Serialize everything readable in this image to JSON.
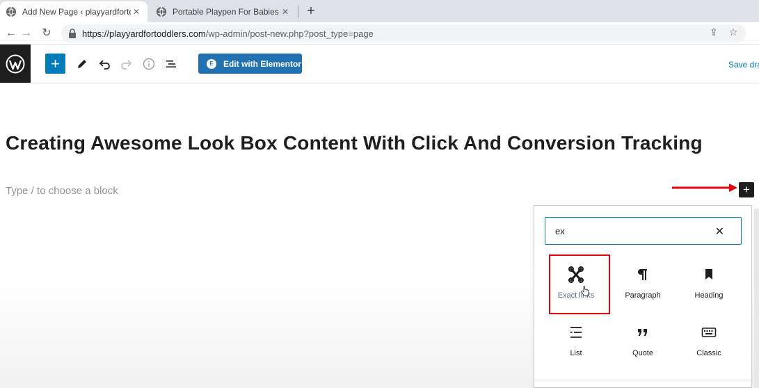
{
  "browser": {
    "tabs": [
      {
        "title": "Add New Page ‹ playyardfortodd",
        "active": true
      },
      {
        "title": "Portable Playpen For Babies [ Pla",
        "active": false
      }
    ],
    "tab_close": "✕",
    "new_tab": "+",
    "url_host": "https://playyardfortoddlers.com",
    "url_path": "/wp-admin/post-new.php?post_type=page"
  },
  "toolbar": {
    "inserter_label": "+",
    "elementor_label": "Edit with Elementor",
    "elementor_icon_glyph": "E",
    "save_draft_label": "Save dra"
  },
  "editor": {
    "post_title": "Creating Awesome Look Box Content With Click And Conversion Tracking",
    "block_placeholder": "Type / to choose a block",
    "inline_inserter": "+"
  },
  "inserter": {
    "search_value": "ex",
    "clear_glyph": "✕",
    "blocks": [
      {
        "label": "Exact links",
        "icon": "exact-links-icon"
      },
      {
        "label": "Paragraph",
        "icon": "paragraph-icon"
      },
      {
        "label": "Heading",
        "icon": "heading-icon"
      },
      {
        "label": "List",
        "icon": "list-icon"
      },
      {
        "label": "Quote",
        "icon": "quote-icon"
      },
      {
        "label": "Classic",
        "icon": "keyboard-icon"
      }
    ]
  },
  "colors": {
    "wp_blue": "#007cba",
    "elementor_blue": "#2271b1",
    "annotation_red": "#e8000b",
    "dark": "#1e1e1e"
  }
}
